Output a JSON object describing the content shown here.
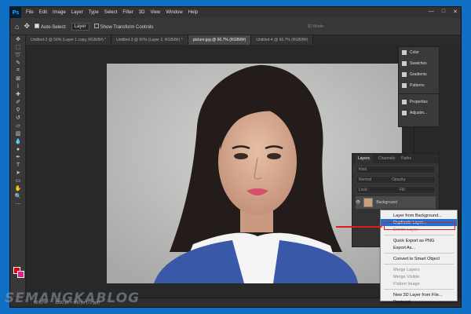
{
  "app": {
    "logo": "Ps"
  },
  "menu": [
    "File",
    "Edit",
    "Image",
    "Layer",
    "Type",
    "Select",
    "Filter",
    "3D",
    "View",
    "Window",
    "Help"
  ],
  "window_controls": {
    "minimize": "—",
    "maximize": "□",
    "close": "✕"
  },
  "options": {
    "auto_select_label": "Auto-Select:",
    "auto_select_value": "Layer",
    "transform_label": "Show Transform Controls",
    "mode_3d": "3D Mode:"
  },
  "tabs": [
    "Untitled-2 @ 50% (Layer 1 copy, RGB/8#) *",
    "Untitled-3 @ 50% (Layer 2, RGB/8#) *",
    "picture.jpg @ 66.7% (RGB/8#)",
    "Untitled-4 @ 66.7% (RGB/8#)"
  ],
  "status": {
    "zoom": "66.67%",
    "doc": "1200 px × 800 px (72 ppi)"
  },
  "dock": {
    "items": [
      "Color",
      "Swatches",
      "Gradients",
      "Patterns",
      "Properties",
      "Adjustm..."
    ]
  },
  "layers_panel": {
    "tabs": [
      "Layers",
      "Channels",
      "Paths"
    ],
    "kind": "Kind",
    "blend": "Normal",
    "opacity": "Opacity:",
    "lock": "Lock:",
    "fill": "Fill:",
    "layer_name": "Background"
  },
  "context_menu": {
    "items": [
      {
        "label": "Layer from Background...",
        "state": "normal"
      },
      {
        "label": "Duplicate Layer...",
        "state": "highlight"
      },
      {
        "label": "Delete Layer",
        "state": "disabled"
      },
      {
        "sep": true
      },
      {
        "label": "Quick Export as PNG",
        "state": "normal"
      },
      {
        "label": "Export As...",
        "state": "normal"
      },
      {
        "sep": true
      },
      {
        "label": "Convert to Smart Object",
        "state": "normal"
      },
      {
        "sep": true
      },
      {
        "label": "Merge Layers",
        "state": "disabled"
      },
      {
        "label": "Merge Visible",
        "state": "disabled"
      },
      {
        "label": "Flatten Image",
        "state": "disabled"
      },
      {
        "sep": true
      },
      {
        "label": "New 3D Layer from File...",
        "state": "normal"
      },
      {
        "label": "Postcard",
        "state": "normal"
      }
    ]
  },
  "colors": {
    "foreground": "#e00010",
    "background": "#e0208a",
    "highlight": "#1e73d2",
    "arrow": "#e21a1a"
  },
  "watermark": "SEMANGKABLOG"
}
